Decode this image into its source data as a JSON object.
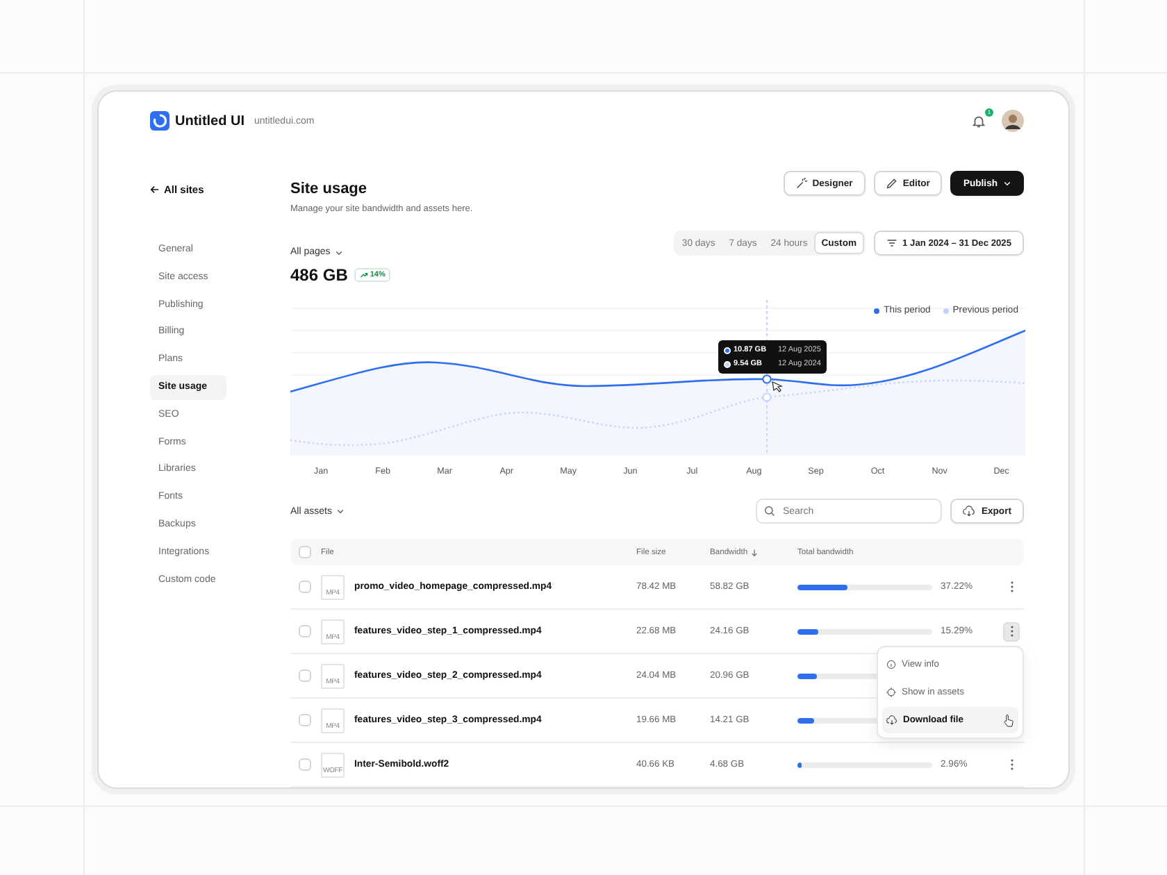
{
  "brand": {
    "name": "Untitled UI",
    "domain": "untitledui.com"
  },
  "header": {
    "notification_badge": "1"
  },
  "back_link": "All sites",
  "sidebar": {
    "items": [
      {
        "label": "General",
        "selected": false
      },
      {
        "label": "Site access",
        "selected": false
      },
      {
        "label": "Publishing",
        "selected": false
      },
      {
        "label": "Billing",
        "selected": false
      },
      {
        "label": "Plans",
        "selected": false
      },
      {
        "label": "Site usage",
        "selected": true
      },
      {
        "label": "SEO",
        "selected": false
      },
      {
        "label": "Forms",
        "selected": false
      },
      {
        "label": "Libraries",
        "selected": false
      },
      {
        "label": "Fonts",
        "selected": false
      },
      {
        "label": "Backups",
        "selected": false
      },
      {
        "label": "Integrations",
        "selected": false
      },
      {
        "label": "Custom code",
        "selected": false
      }
    ]
  },
  "page": {
    "title": "Site usage",
    "subtitle": "Manage your site bandwidth and assets here.",
    "actions": [
      {
        "label": "Designer",
        "kind": "designer"
      },
      {
        "label": "Editor",
        "kind": "editor"
      },
      {
        "label": "Publish",
        "kind": "publish"
      }
    ]
  },
  "summary": {
    "filter": "All pages",
    "value": "486 GB",
    "change": "14%"
  },
  "ranges": [
    {
      "label": "30 days",
      "selected": false
    },
    {
      "label": "7 days",
      "selected": false
    },
    {
      "label": "24 hours",
      "selected": false
    },
    {
      "label": "Custom",
      "selected": true
    }
  ],
  "date_range": "1 Jan 2024 – 31 Dec 2025",
  "chart": {
    "legend": [
      {
        "label": "This period",
        "color": "#2e6ff0"
      },
      {
        "label": "Previous period",
        "color": "#c3d3fb"
      }
    ],
    "months": [
      "Jan",
      "Feb",
      "Mar",
      "Apr",
      "May",
      "Jun",
      "Jul",
      "Aug",
      "Sep",
      "Oct",
      "Nov",
      "Dec"
    ],
    "tooltip": [
      {
        "value": "10.87 GB",
        "date": "12 Aug 2025"
      },
      {
        "value": "9.54 GB",
        "date": "12 Aug 2024"
      }
    ]
  },
  "assets": {
    "filter": "All assets",
    "search": {
      "placeholder": "Search"
    },
    "export": "Export",
    "select_all": {
      "checked": false
    },
    "columns": [
      "File",
      "File size",
      "Bandwidth",
      "Total bandwidth"
    ],
    "rows": [
      {
        "type": "MP4",
        "name": "promo_video_homepage_compressed.mp4",
        "size": "78.42 MB",
        "bandwidth": "58.82 GB",
        "level": 0.37,
        "share": "37.22%",
        "checked": false,
        "menu_open": false
      },
      {
        "type": "MP4",
        "name": "features_video_step_1_compressed.mp4",
        "size": "22.68 MB",
        "bandwidth": "24.16 GB",
        "level": 0.15,
        "share": "15.29%",
        "checked": false,
        "menu_open": true
      },
      {
        "type": "MP4",
        "name": "features_video_step_2_compressed.mp4",
        "size": "24.04 MB",
        "bandwidth": "20.96 GB",
        "level": 0.14,
        "checked": false,
        "menu_open": false
      },
      {
        "type": "MP4",
        "name": "features_video_step_3_compressed.mp4",
        "size": "19.66 MB",
        "bandwidth": "14.21 GB",
        "level": 0.12,
        "checked": false,
        "menu_open": false
      },
      {
        "type": "WOFF",
        "name": "Inter-Semibold.woff2",
        "size": "40.66 KB",
        "bandwidth": "4.68 GB",
        "level": 0.03,
        "share": "2.96%",
        "checked": false,
        "menu_open": false
      }
    ]
  },
  "row_menu": [
    {
      "label": "View info",
      "kind": "info",
      "selected": false
    },
    {
      "label": "Show in assets",
      "kind": "locate",
      "selected": false
    },
    {
      "label": "Download file",
      "kind": "download",
      "selected": true
    }
  ]
}
